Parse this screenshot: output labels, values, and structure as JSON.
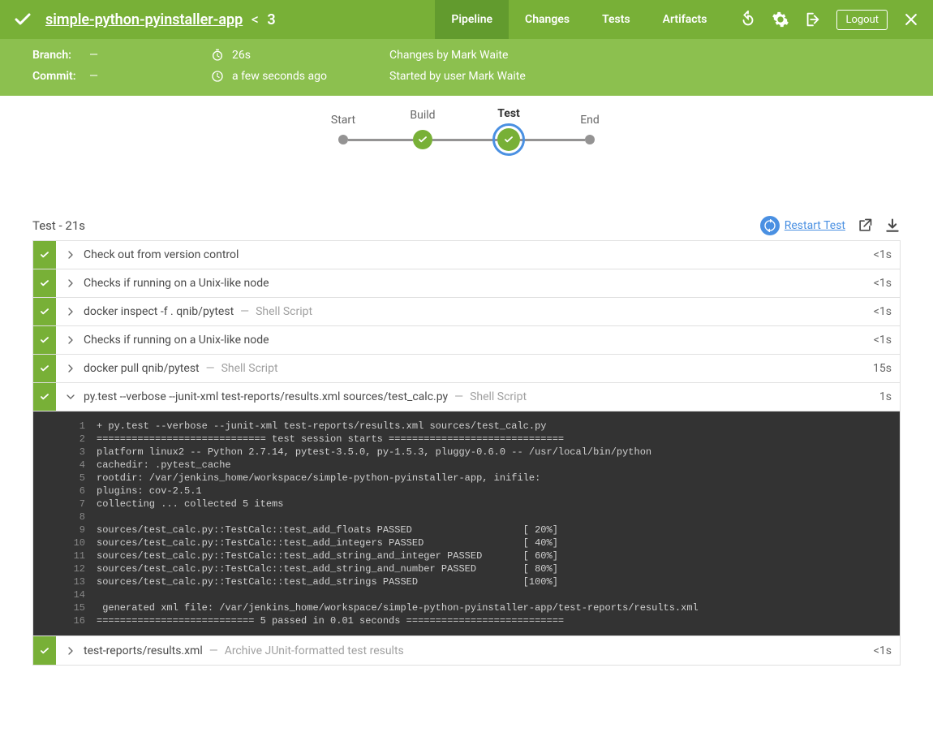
{
  "header": {
    "project_name": "simple-python-pyinstaller-app",
    "run_number": "3",
    "tabs": [
      "Pipeline",
      "Changes",
      "Tests",
      "Artifacts"
    ],
    "active_tab": 0,
    "logout_label": "Logout"
  },
  "info": {
    "branch_label": "Branch:",
    "branch_value": "—",
    "commit_label": "Commit:",
    "commit_value": "—",
    "duration": "26s",
    "when": "a few seconds ago",
    "changes_by": "Changes by Mark Waite",
    "started_by": "Started by user Mark Waite"
  },
  "stages": [
    {
      "label": "Start",
      "type": "dot"
    },
    {
      "label": "Build",
      "type": "check"
    },
    {
      "label": "Test",
      "type": "check",
      "selected": true
    },
    {
      "label": "End",
      "type": "dot"
    }
  ],
  "section": {
    "title": "Test - 21s",
    "restart_label": "Restart Test"
  },
  "steps": [
    {
      "title": "Check out from version control",
      "dur": "<1s",
      "expanded": false
    },
    {
      "title": "Checks if running on a Unix-like node",
      "dur": "<1s",
      "expanded": false
    },
    {
      "title": "docker inspect -f . qnib/pytest",
      "annot": "Shell Script",
      "dur": "<1s",
      "expanded": false
    },
    {
      "title": "Checks if running on a Unix-like node",
      "dur": "<1s",
      "expanded": false
    },
    {
      "title": "docker pull qnib/pytest",
      "annot": "Shell Script",
      "dur": "15s",
      "expanded": false
    },
    {
      "title": "py.test --verbose --junit-xml test-reports/results.xml sources/test_calc.py",
      "annot": "Shell Script",
      "dur": "1s",
      "expanded": true
    },
    {
      "title": "test-reports/results.xml",
      "annot": "Archive JUnit-formatted test results",
      "dur": "<1s",
      "expanded": false
    }
  ],
  "console_lines": [
    "+ py.test --verbose --junit-xml test-reports/results.xml sources/test_calc.py",
    "============================= test session starts ==============================",
    "platform linux2 -- Python 2.7.14, pytest-3.5.0, py-1.5.3, pluggy-0.6.0 -- /usr/local/bin/python",
    "cachedir: .pytest_cache",
    "rootdir: /var/jenkins_home/workspace/simple-python-pyinstaller-app, inifile:",
    "plugins: cov-2.5.1",
    "collecting ... collected 5 items",
    "",
    "sources/test_calc.py::TestCalc::test_add_floats PASSED                   [ 20%]",
    "sources/test_calc.py::TestCalc::test_add_integers PASSED                 [ 40%]",
    "sources/test_calc.py::TestCalc::test_add_string_and_integer PASSED       [ 60%]",
    "sources/test_calc.py::TestCalc::test_add_string_and_number PASSED        [ 80%]",
    "sources/test_calc.py::TestCalc::test_add_strings PASSED                  [100%]",
    "",
    " generated xml file: /var/jenkins_home/workspace/simple-python-pyinstaller-app/test-reports/results.xml ",
    "=========================== 5 passed in 0.01 seconds ==========================="
  ]
}
